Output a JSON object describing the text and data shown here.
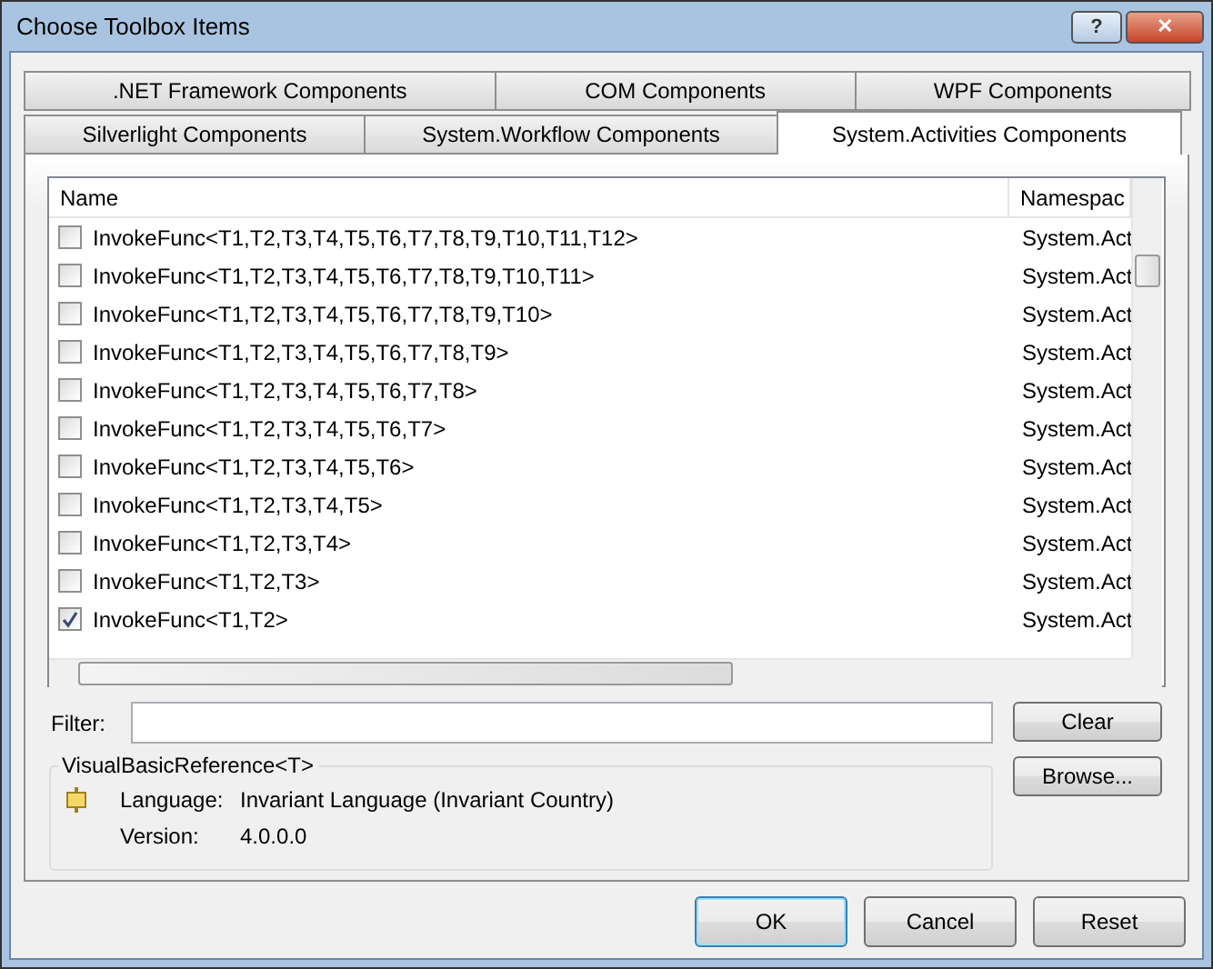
{
  "window": {
    "title": "Choose Toolbox Items",
    "buttons": [
      {
        "kind": "help",
        "label": "?"
      },
      {
        "kind": "close",
        "label": "✕"
      }
    ]
  },
  "tab_rows": [
    [
      {
        "label": ".NET Framework Components",
        "selected": false
      },
      {
        "label": "COM Components",
        "selected": false
      },
      {
        "label": "WPF Components",
        "selected": false
      }
    ],
    [
      {
        "label": "Silverlight Components",
        "selected": false
      },
      {
        "label": "System.Workflow Components",
        "selected": false
      },
      {
        "label": "System.Activities Components",
        "selected": true
      }
    ]
  ],
  "table": {
    "columns": [
      "Name",
      "Namespac"
    ],
    "rows": [
      {
        "name": "InvokeFunc<T1,T2,T3,T4,T5,T6,T7,T8,T9,T10,T11,T12>",
        "namespace": "System.Act",
        "checked": false
      },
      {
        "name": "InvokeFunc<T1,T2,T3,T4,T5,T6,T7,T8,T9,T10,T11>",
        "namespace": "System.Act",
        "checked": false
      },
      {
        "name": "InvokeFunc<T1,T2,T3,T4,T5,T6,T7,T8,T9,T10>",
        "namespace": "System.Act",
        "checked": false
      },
      {
        "name": "InvokeFunc<T1,T2,T3,T4,T5,T6,T7,T8,T9>",
        "namespace": "System.Act",
        "checked": false
      },
      {
        "name": "InvokeFunc<T1,T2,T3,T4,T5,T6,T7,T8>",
        "namespace": "System.Act",
        "checked": false
      },
      {
        "name": "InvokeFunc<T1,T2,T3,T4,T5,T6,T7>",
        "namespace": "System.Act",
        "checked": false
      },
      {
        "name": "InvokeFunc<T1,T2,T3,T4,T5,T6>",
        "namespace": "System.Act",
        "checked": false
      },
      {
        "name": "InvokeFunc<T1,T2,T3,T4,T5>",
        "namespace": "System.Act",
        "checked": false
      },
      {
        "name": "InvokeFunc<T1,T2,T3,T4>",
        "namespace": "System.Act",
        "checked": false
      },
      {
        "name": "InvokeFunc<T1,T2,T3>",
        "namespace": "System.Act",
        "checked": false
      },
      {
        "name": "InvokeFunc<T1,T2>",
        "namespace": "System.Act",
        "checked": true
      }
    ]
  },
  "filter": {
    "label": "Filter:"
  },
  "details": {
    "title": "VisualBasicReference<T>",
    "fields": [
      {
        "label": "Language:",
        "value": "Invariant Language (Invariant Country)"
      },
      {
        "label": "Version:",
        "value": "4.0.0.0"
      }
    ]
  },
  "side_buttons": [
    "Clear",
    "Browse..."
  ],
  "buttons": [
    {
      "label": "OK",
      "default": true
    },
    {
      "label": "Cancel",
      "default": false
    },
    {
      "label": "Reset",
      "default": false
    }
  ]
}
